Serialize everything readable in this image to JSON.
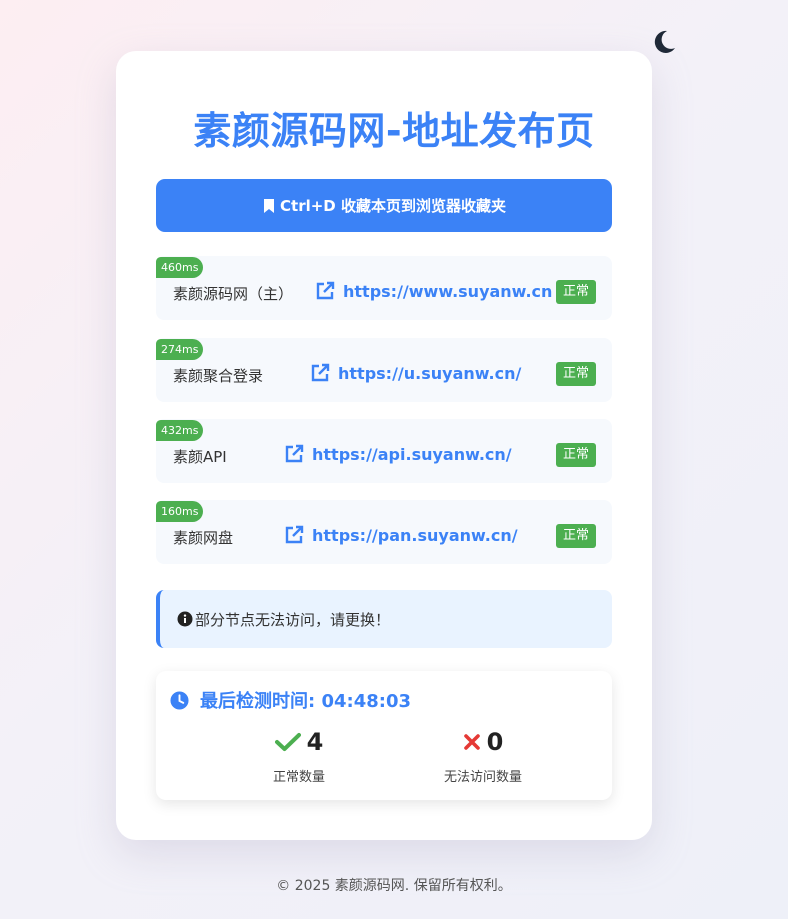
{
  "header": {
    "title": "素颜源码网-地址发布页",
    "theme_toggle_icon": "moon-icon"
  },
  "bookmark": {
    "label": "Ctrl+D 收藏本页到浏览器收藏夹",
    "icon": "bookmark-icon"
  },
  "links": [
    {
      "latency": "460ms",
      "name": "素颜源码网（主）",
      "url": "https://www.suyanw.cn",
      "status": "正常"
    },
    {
      "latency": "274ms",
      "name": "素颜聚合登录",
      "url": "https://u.suyanw.cn/",
      "status": "正常"
    },
    {
      "latency": "432ms",
      "name": "素颜API",
      "url": "https://api.suyanw.cn/",
      "status": "正常"
    },
    {
      "latency": "160ms",
      "name": "素颜网盘",
      "url": "https://pan.suyanw.cn/",
      "status": "正常"
    }
  ],
  "notice": {
    "text": "部分节点无法访问，请更换！",
    "icon": "info-icon"
  },
  "stats": {
    "check_time_label": "最后检测时间: 04:48:03",
    "ok_count": "4",
    "ok_label": "正常数量",
    "fail_count": "0",
    "fail_label": "无法访问数量"
  },
  "footer": {
    "text": "© 2025 素颜源码网. 保留所有权利。"
  },
  "colors": {
    "accent": "#3b82f6",
    "success": "#4caf50",
    "danger": "#e53935",
    "notice_bg": "#e9f3ff"
  }
}
